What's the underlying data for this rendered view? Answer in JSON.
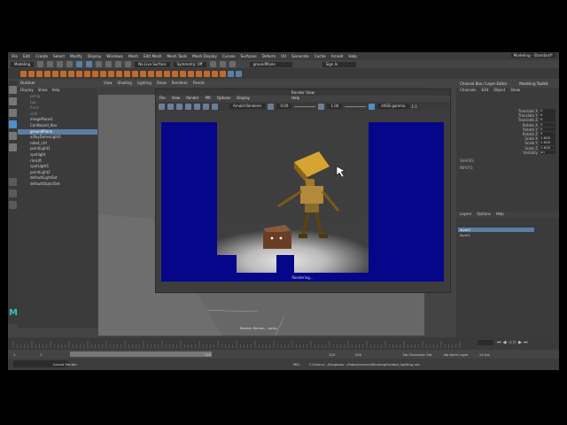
{
  "menubar": {
    "items": [
      "File",
      "Edit",
      "Create",
      "Select",
      "Modify",
      "Display",
      "Windows",
      "Mesh",
      "Edit Mesh",
      "Mesh Tools",
      "Mesh Display",
      "Curves",
      "Surfaces",
      "Deform",
      "UV",
      "Generate",
      "Cache",
      "Arnold",
      "Help"
    ],
    "workspace_label": "Workspace:",
    "workspace_value": "Modeling - Standard*"
  },
  "statusline": {
    "mode": "Modeling",
    "no_live_surface": "No Live Surface",
    "symmetry": "Symmetry: Off",
    "object_field": "groundPlane",
    "sign_in": "Sign In"
  },
  "outliner": {
    "title": "Outliner",
    "menu": [
      "Display",
      "Show",
      "Help"
    ],
    "items": [
      {
        "label": "persp",
        "style": "dim"
      },
      {
        "label": "top",
        "style": "dim"
      },
      {
        "label": "front",
        "style": "dim"
      },
      {
        "label": "side",
        "style": "dim"
      },
      {
        "label": "imagePlane1",
        "style": "normal"
      },
      {
        "label": "Cardboard_Box",
        "style": "normal"
      },
      {
        "label": "groundPlane",
        "style": "sel"
      },
      {
        "label": "aiSkyDomeLight1",
        "style": "normal"
      },
      {
        "label": "robot_ctrl",
        "style": "normal"
      },
      {
        "label": "pointLight1",
        "style": "normal"
      },
      {
        "label": "spotlight",
        "style": "normal"
      },
      {
        "label": "rimLift",
        "style": "normal"
      },
      {
        "label": "spotLight1",
        "style": "normal"
      },
      {
        "label": "pointLight2",
        "style": "normal"
      },
      {
        "label": "defaultLightSet",
        "style": "normal"
      },
      {
        "label": "defaultObjectSet",
        "style": "normal"
      }
    ]
  },
  "viewport": {
    "menu": [
      "View",
      "Shading",
      "Lighting",
      "Show",
      "Renderer",
      "Panels"
    ],
    "camera_label": "Modern Render... persp"
  },
  "render_view": {
    "title": "Render View",
    "menu": [
      "File",
      "View",
      "Render",
      "IPR",
      "Options",
      "Display",
      "Help"
    ],
    "renderer": "Arnold Renderer",
    "exposure": "0.00",
    "gamma": "1.00",
    "colorspace": "sRGB gamma",
    "ratio": "1:1",
    "status": "Rendering..."
  },
  "channel_box": {
    "tabs": [
      "Channel Box / Layer Editor",
      "Modeling Toolkit"
    ],
    "menu": [
      "Channels",
      "Edit",
      "Object",
      "Show"
    ],
    "attributes": [
      {
        "name": "Translate X",
        "value": "0"
      },
      {
        "name": "Translate Y",
        "value": "0"
      },
      {
        "name": "Translate Z",
        "value": "0"
      },
      {
        "name": "Rotate X",
        "value": "0"
      },
      {
        "name": "Rotate Y",
        "value": "0"
      },
      {
        "name": "Rotate Z",
        "value": "0"
      },
      {
        "name": "Scale X",
        "value": "1.628"
      },
      {
        "name": "Scale Y",
        "value": "1.628"
      },
      {
        "name": "Scale Z",
        "value": "1.628"
      },
      {
        "name": "Visibility",
        "value": "on"
      }
    ],
    "shapes_label": "SHAPES",
    "inputs_label": "INPUTS",
    "layers_menu": [
      "Layers",
      "Options",
      "Help"
    ],
    "layers": [
      "layer2",
      "layer1"
    ]
  },
  "timeline": {
    "start": "1",
    "current": "120",
    "range_start": "1",
    "range_end": "120",
    "max_end": "200",
    "fps": "24 fps",
    "character": "No Character Set",
    "anim_layer": "No Anim Layer"
  },
  "command_line": {
    "mode": "MEL",
    "result": "C:/Users/.../Dropbox/.../Robot/scenes/Rectangle/robot_lighting.mb",
    "arnold": "Arnold Render"
  },
  "colors": {
    "render_bg": "#06068a",
    "selection": "#5a7ea3",
    "maya_logo": "#35c3b8"
  }
}
